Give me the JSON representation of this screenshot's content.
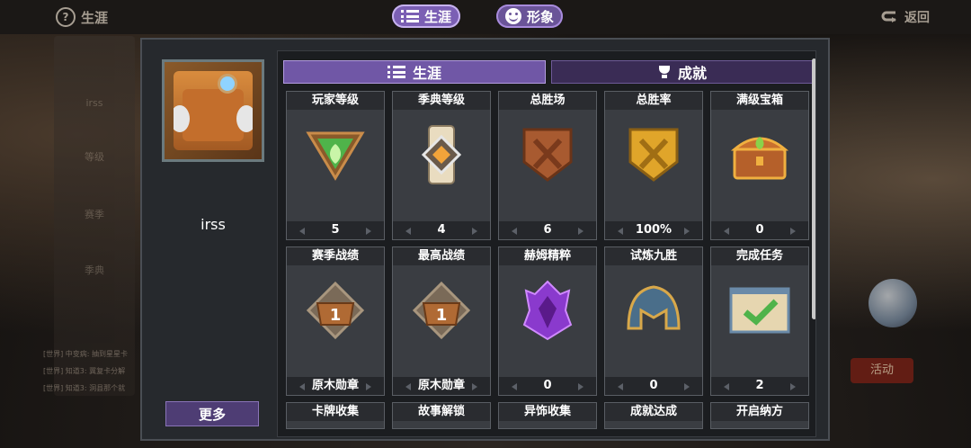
{
  "topbar": {
    "career_label": "生涯",
    "career_tab": "生涯",
    "appearance_tab": "形象",
    "back_label": "返回"
  },
  "profile": {
    "name": "irss",
    "more_label": "更多"
  },
  "sub_tabs": {
    "career": "生涯",
    "achievements": "成就"
  },
  "cards": [
    {
      "title": "玩家等级",
      "value": "5",
      "icon": "green-triangle-badge-icon"
    },
    {
      "title": "季典等级",
      "value": "4",
      "icon": "scroll-badge-icon"
    },
    {
      "title": "总胜场",
      "value": "6",
      "icon": "bronze-crossed-swords-shield-icon"
    },
    {
      "title": "总胜率",
      "value": "100%",
      "icon": "gold-crossed-swords-shield-icon"
    },
    {
      "title": "满级宝箱",
      "value": "0",
      "icon": "treasure-chest-icon"
    },
    {
      "title": "赛季战绩",
      "value": "原木勋章",
      "icon": "wooden-medal-icon"
    },
    {
      "title": "最高战绩",
      "value": "原木勋章",
      "icon": "wooden-medal-icon"
    },
    {
      "title": "赫姆精粹",
      "value": "0",
      "icon": "purple-crystal-icon"
    },
    {
      "title": "试炼九胜",
      "value": "0",
      "icon": "helmet-icon"
    },
    {
      "title": "完成任务",
      "value": "2",
      "icon": "checkmark-scroll-icon"
    }
  ],
  "partial_cards": [
    "卡牌收集",
    "故事解锁",
    "异饰收集",
    "成就达成",
    "开启纳方"
  ],
  "background": {
    "side_name": "irss",
    "side_level": "等级",
    "side_season": "赛季",
    "side_codex": "季典",
    "chat_lines": [
      "[世界] 中变病: 抽到星星卡",
      "[世界] 知道3: 冀复卡分解",
      "[世界] 知道3: 洞县那个就"
    ],
    "activity_label": "活动"
  },
  "colors": {
    "accent": "#7b5fb4",
    "panel": "#26292d",
    "card": "#3a3d42"
  }
}
